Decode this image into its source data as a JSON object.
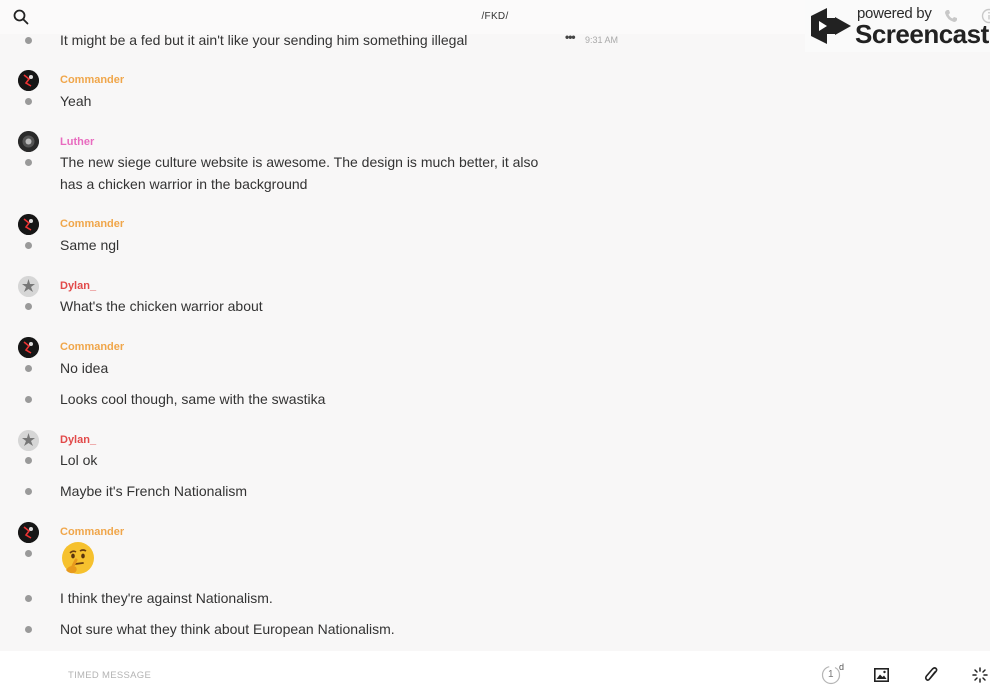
{
  "header": {
    "title": "/FKD/",
    "search_icon": "search-icon"
  },
  "watermark": {
    "powered_by": "powered by",
    "brand": "Screencastify"
  },
  "messages": [
    {
      "text": "It might be a fed but it ain't like your sending him something illegal",
      "time": "9:31 AM"
    },
    {
      "author": "Commander",
      "text": "Yeah"
    },
    {
      "author": "Luther",
      "text": "The new siege culture website is awesome. The design is much better, it also has a chicken warrior in the background"
    },
    {
      "author": "Commander",
      "text": "Same ngl"
    },
    {
      "author": "Dylan_",
      "text": "What's the chicken warrior about"
    },
    {
      "author": "Commander",
      "text": "No idea"
    },
    {
      "text": "Looks cool though, same with the swastika"
    },
    {
      "author": "Dylan_",
      "text": "Lol ok"
    },
    {
      "text": "Maybe it's French Nationalism"
    },
    {
      "author": "Commander",
      "emoji": "thinking-face-emoji"
    },
    {
      "text": "I think they're against Nationalism."
    },
    {
      "text": "Not sure what they think about European Nationalism."
    }
  ],
  "composer": {
    "placeholder": "TIMED MESSAGE",
    "timer_value": "1",
    "timer_unit": "d"
  },
  "colors": {
    "commander": "#f0a64a",
    "luther": "#e86bbf",
    "dylan": "#e24a4a"
  }
}
